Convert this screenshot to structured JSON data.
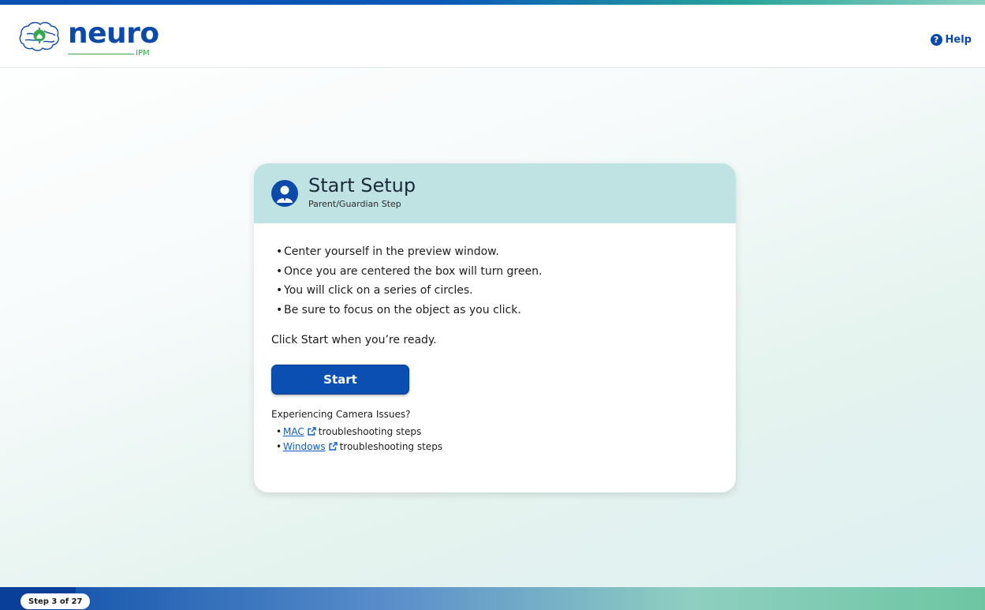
{
  "brand": {
    "name": "neuro",
    "sub": "IPM"
  },
  "header": {
    "help_label": "Help",
    "help_icon": "?"
  },
  "card": {
    "title": "Start Setup",
    "subtitle": "Parent/Guardian Step",
    "bullets": [
      "Center yourself in the preview window.",
      "Once you are centered the box will turn green.",
      "You will click on a series of circles.",
      "Be sure to focus on the object as you click."
    ],
    "ready_text": "Click Start when you’re ready.",
    "start_label": "Start",
    "camera": {
      "title": "Experiencing Camera Issues?",
      "links": [
        {
          "label": "MAC",
          "suffix": "troubleshooting steps"
        },
        {
          "label": "Windows",
          "suffix": "troubleshooting steps"
        }
      ]
    }
  },
  "footer": {
    "step_text": "Step 3 of 27",
    "progress": {
      "current": 3,
      "total": 27
    }
  },
  "colors": {
    "brand_blue": "#0b4aa8",
    "brand_green": "#36a84c",
    "card_header": "#bfe3e3",
    "link": "#0b5cc9"
  }
}
